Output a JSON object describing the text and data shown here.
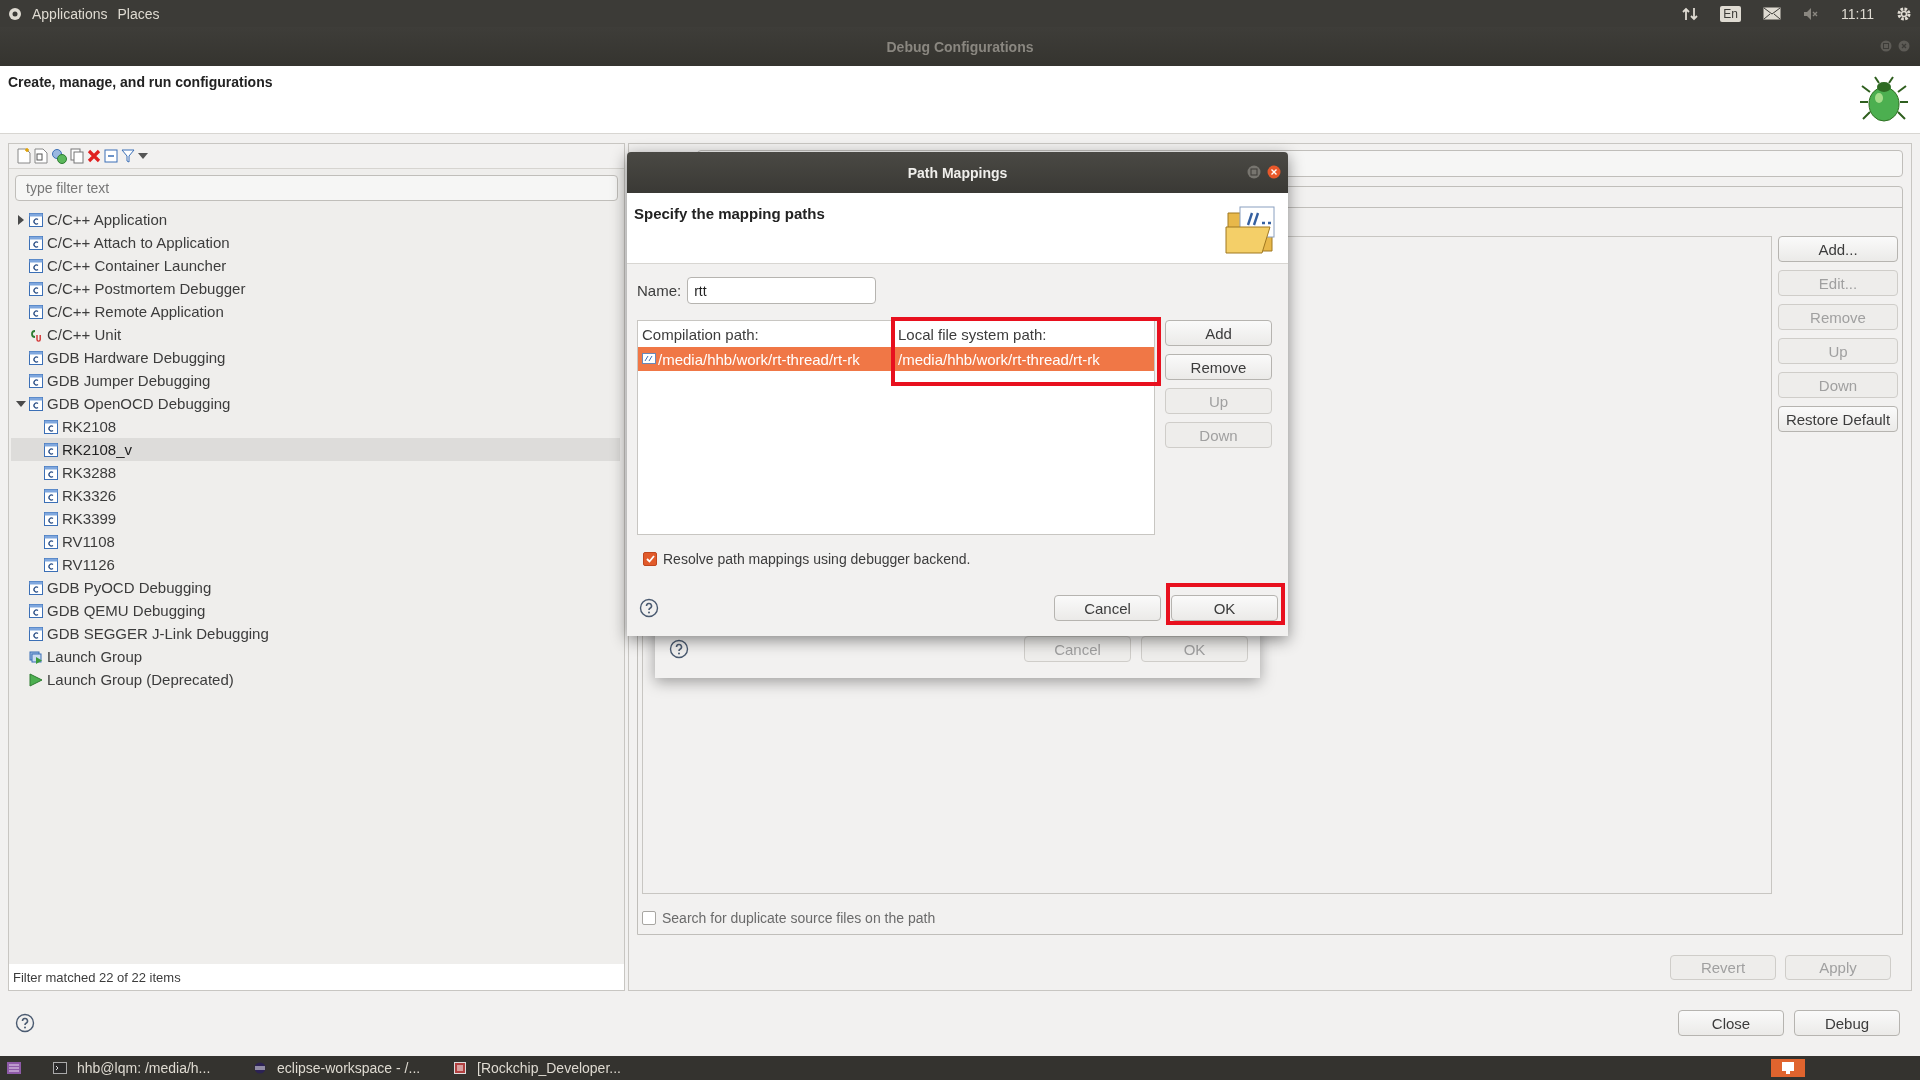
{
  "top_panel": {
    "menus": [
      "Applications",
      "Places"
    ],
    "keyboard": "En",
    "time": "11:11"
  },
  "window": {
    "title": "Debug Configurations",
    "header": "Create, manage, and run configurations"
  },
  "left_panel": {
    "filter": {
      "placeholder": "type filter text"
    },
    "tree": [
      {
        "label": "C/C++ Application",
        "kind": "config",
        "expanded": false,
        "selected": false
      },
      {
        "label": "C/C++ Attach to Application",
        "kind": "config",
        "selected": false
      },
      {
        "label": "C/C++ Container Launcher",
        "kind": "config",
        "selected": false
      },
      {
        "label": "C/C++ Postmortem Debugger",
        "kind": "config",
        "selected": false
      },
      {
        "label": "C/C++ Remote Application",
        "kind": "config",
        "selected": false
      },
      {
        "label": "C/C++ Unit",
        "kind": "unit",
        "selected": false
      },
      {
        "label": "GDB Hardware Debugging",
        "kind": "config",
        "selected": false
      },
      {
        "label": "GDB Jumper Debugging",
        "kind": "config",
        "selected": false
      },
      {
        "label": "GDB OpenOCD Debugging",
        "kind": "config",
        "expanded": true,
        "selected": false,
        "children": [
          {
            "label": "RK2108",
            "kind": "config",
            "selected": false
          },
          {
            "label": "RK2108_v",
            "kind": "config",
            "selected": true
          },
          {
            "label": "RK3288",
            "kind": "config",
            "selected": false
          },
          {
            "label": "RK3326",
            "kind": "config",
            "selected": false
          },
          {
            "label": "RK3399",
            "kind": "config",
            "selected": false
          },
          {
            "label": "RV1108",
            "kind": "config",
            "selected": false
          },
          {
            "label": "RV1126",
            "kind": "config",
            "selected": false
          }
        ]
      },
      {
        "label": "GDB PyOCD Debugging",
        "kind": "config",
        "selected": false
      },
      {
        "label": "GDB QEMU Debugging",
        "kind": "config",
        "selected": false
      },
      {
        "label": "GDB SEGGER J-Link Debugging",
        "kind": "config",
        "selected": false
      },
      {
        "label": "Launch Group",
        "kind": "group",
        "selected": false
      },
      {
        "label": "Launch Group (Deprecated)",
        "kind": "play",
        "selected": false
      }
    ],
    "status": "Filter matched 22 of 22 items"
  },
  "right_panel": {
    "side_buttons": [
      {
        "label": "Add...",
        "disabled": false
      },
      {
        "label": "Edit...",
        "disabled": true
      },
      {
        "label": "Remove",
        "disabled": true
      },
      {
        "label": "Up",
        "disabled": true
      },
      {
        "label": "Down",
        "disabled": true
      },
      {
        "label": "Restore Default",
        "disabled": false
      }
    ],
    "duplicate_search": {
      "label": "Search for duplicate source files on the path",
      "checked": false
    },
    "buttons": [
      {
        "label": "Revert",
        "disabled": true
      },
      {
        "label": "Apply",
        "disabled": true
      }
    ]
  },
  "footer_buttons": [
    {
      "label": "Close",
      "disabled": false
    },
    {
      "label": "Debug",
      "disabled": false
    }
  ],
  "background_dialog": {
    "buttons": [
      {
        "label": "Cancel",
        "disabled": true
      },
      {
        "label": "OK",
        "disabled": true
      }
    ]
  },
  "dialog": {
    "title": "Path Mappings",
    "header": "Specify the mapping paths",
    "name": {
      "label": "Name:",
      "value": "rtt"
    },
    "table": {
      "columns": [
        {
          "label": "Compilation path:"
        },
        {
          "label": "Local file system path:",
          "highlighted": true
        }
      ],
      "rows": [
        {
          "cells": [
            "/media/hhb/work/rt-thread/rt-rk",
            "/media/hhb/work/rt-thread/rt-rk"
          ],
          "selected": true
        }
      ]
    },
    "side_buttons": [
      {
        "label": "Add",
        "disabled": false
      },
      {
        "label": "Remove",
        "disabled": false
      },
      {
        "label": "Up",
        "disabled": true
      },
      {
        "label": "Down",
        "disabled": true
      }
    ],
    "resolve": {
      "label": "Resolve path mappings using debugger backend.",
      "checked": true
    },
    "buttons": [
      {
        "label": "Cancel",
        "disabled": false
      },
      {
        "label": "OK",
        "disabled": false,
        "highlighted": true
      }
    ]
  },
  "taskbar": [
    {
      "label": "hhb@lqm: /media/h...",
      "kind": "terminal"
    },
    {
      "label": "eclipse-workspace - /...",
      "kind": "eclipse"
    },
    {
      "label": "[Rockchip_Developer...",
      "kind": "document"
    }
  ]
}
